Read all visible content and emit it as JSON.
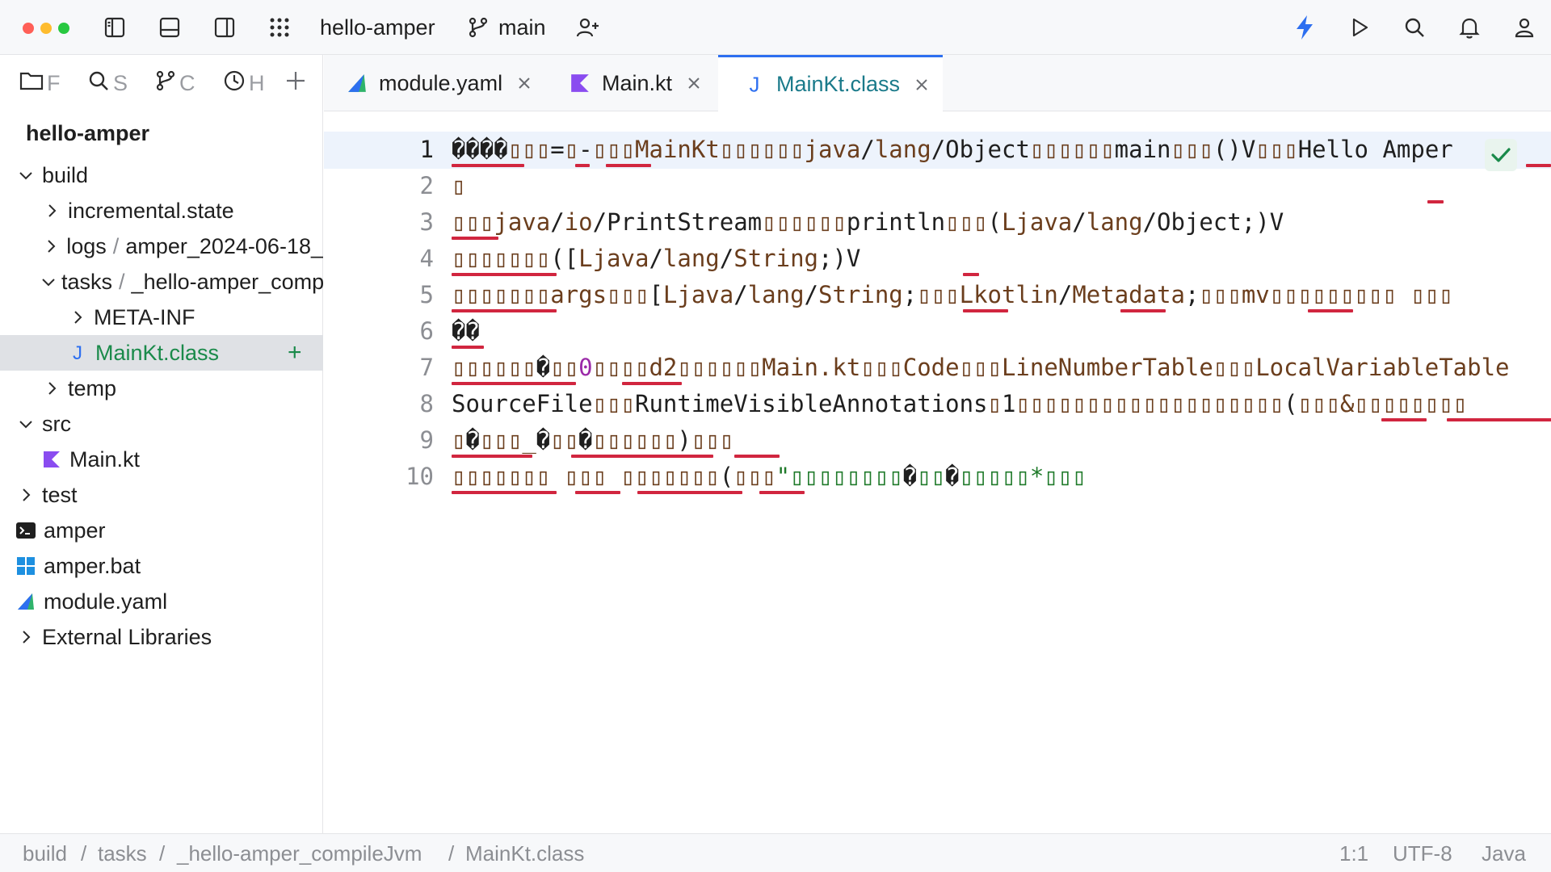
{
  "window": {
    "project_name": "hello-amper",
    "branch": "main"
  },
  "colors": {
    "accent": "#2d6ff0",
    "kotlin": "#8a4cf0",
    "java": "#2d6ff0",
    "error_underline": "#d1263f",
    "added_green": "#1a8a4a"
  },
  "sidebar": {
    "tabs": [
      {
        "label": "F",
        "icon": "folder-icon"
      },
      {
        "label": "S",
        "icon": "search-icon"
      },
      {
        "label": "C",
        "icon": "branch-icon"
      },
      {
        "label": "H",
        "icon": "clock-icon"
      },
      {
        "label": "+",
        "icon": "plus-icon"
      }
    ],
    "project_title": "hello-amper",
    "tree": [
      {
        "label": "build"
      },
      {
        "label": "incremental.state"
      },
      {
        "label": "logs",
        "suffix": "amper_2024-06-18_"
      },
      {
        "label": "tasks",
        "suffix": "_hello-amper_compileJvm"
      },
      {
        "label": "META-INF"
      },
      {
        "label": "MainKt.class",
        "badge": "+"
      },
      {
        "label": "temp"
      },
      {
        "label": "src"
      },
      {
        "label": "Main.kt"
      },
      {
        "label": "test"
      },
      {
        "label": "amper"
      },
      {
        "label": "amper.bat"
      },
      {
        "label": "module.yaml"
      },
      {
        "label": "External Libraries"
      }
    ]
  },
  "editor_tabs": [
    {
      "label": "module.yaml",
      "icon": "amper-icon"
    },
    {
      "label": "Main.kt",
      "icon": "kotlin-icon"
    },
    {
      "label": "MainKt.class",
      "icon": "java-icon",
      "active": true
    }
  ],
  "editor": {
    "line_numbers": [
      "1",
      "2",
      "3",
      "4",
      "5",
      "6",
      "7",
      "8",
      "9",
      "10"
    ],
    "lines": [
      [
        [
          "blk",
          "����"
        ],
        [
          "brown",
          "▯▯▯"
        ],
        [
          "blk",
          "="
        ],
        [
          "brown",
          "▯"
        ],
        [
          "blk",
          "-"
        ],
        [
          "brown",
          "▯▯▯MainKt▯▯▯▯▯▯java"
        ],
        [
          "blk",
          "/"
        ],
        [
          "brown",
          "lang"
        ],
        [
          "blk",
          "/Object"
        ],
        [
          "brown",
          "▯▯▯▯▯▯"
        ],
        [
          "blk",
          "main"
        ],
        [
          "brown",
          "▯▯▯"
        ],
        [
          "blk",
          "()V"
        ],
        [
          "brown",
          "▯▯▯"
        ],
        [
          "blk",
          "Hello Amper"
        ]
      ],
      [
        [
          "brown",
          "▯"
        ]
      ],
      [
        [
          "brown",
          "▯▯▯java"
        ],
        [
          "blk",
          "/"
        ],
        [
          "brown",
          "io"
        ],
        [
          "blk",
          "/PrintStream"
        ],
        [
          "brown",
          "▯▯▯▯▯▯"
        ],
        [
          "blk",
          "println"
        ],
        [
          "brown",
          "▯▯▯"
        ],
        [
          "blk",
          "("
        ],
        [
          "brown",
          "Ljava"
        ],
        [
          "blk",
          "/"
        ],
        [
          "brown",
          "lang"
        ],
        [
          "blk",
          "/Object;)V"
        ]
      ],
      [
        [
          "brown",
          "▯▯▯▯▯▯▯"
        ],
        [
          "blk",
          "(["
        ],
        [
          "brown",
          "Ljava"
        ],
        [
          "blk",
          "/"
        ],
        [
          "brown",
          "lang"
        ],
        [
          "blk",
          "/"
        ],
        [
          "brown",
          "String"
        ],
        [
          "blk",
          ";)V"
        ]
      ],
      [
        [
          "brown",
          "▯▯▯▯▯▯▯args▯▯▯"
        ],
        [
          "blk",
          "["
        ],
        [
          "brown",
          "Ljava"
        ],
        [
          "blk",
          "/"
        ],
        [
          "brown",
          "lang"
        ],
        [
          "blk",
          "/"
        ],
        [
          "brown",
          "String"
        ],
        [
          "blk",
          ";"
        ],
        [
          "brown",
          "▯▯▯Lkotlin"
        ],
        [
          "blk",
          "/"
        ],
        [
          "brown",
          "Metadata"
        ],
        [
          "blk",
          ";"
        ],
        [
          "brown",
          "▯▯▯mv▯▯▯▯▯▯▯▯▯ ▯▯▯"
        ]
      ],
      [
        [
          "blk",
          "��"
        ]
      ],
      [
        [
          "brown",
          "▯▯▯▯▯▯"
        ],
        [
          "blk",
          "�"
        ],
        [
          "brown",
          "▯▯"
        ],
        [
          "pur",
          "0"
        ],
        [
          "brown",
          "▯▯▯▯d2▯▯▯▯▯▯Main.kt▯▯▯Code▯▯▯LineNumberTable▯▯▯LocalVariableTable"
        ]
      ],
      [
        [
          "blk",
          "SourceFile"
        ],
        [
          "brown",
          "▯▯▯"
        ],
        [
          "blk",
          "RuntimeVisibleAnnotations"
        ],
        [
          "brown",
          "▯"
        ],
        [
          "blk",
          "1"
        ],
        [
          "brown",
          "▯▯▯▯▯▯▯▯▯▯▯▯▯▯▯▯▯▯▯"
        ],
        [
          "blk",
          "("
        ],
        [
          "brown",
          "▯▯▯&▯▯▯▯▯▯▯▯"
        ]
      ],
      [
        [
          "brown",
          "▯"
        ],
        [
          "blk",
          "�"
        ],
        [
          "brown",
          "▯▯▯_"
        ],
        [
          "blk",
          "�"
        ],
        [
          "brown",
          "▯▯"
        ],
        [
          "blk",
          "�"
        ],
        [
          "brown",
          "▯▯▯▯▯▯"
        ],
        [
          "blk",
          ")"
        ],
        [
          "brown",
          "▯▯▯"
        ]
      ],
      [
        [
          "brown",
          "▯▯▯▯▯▯▯ ▯▯▯ ▯▯▯▯▯▯▯"
        ],
        [
          "blk",
          "("
        ],
        [
          "brown",
          "▯▯▯"
        ],
        [
          "grn",
          "\"▯▯▯▯▯▯▯▯"
        ],
        [
          "blk",
          "�"
        ],
        [
          "grn",
          "▯▯"
        ],
        [
          "blk",
          "�"
        ],
        [
          "grn",
          "▯▯▯▯▯*▯▯▯"
        ]
      ]
    ]
  },
  "statusbar": {
    "breadcrumbs": [
      "build",
      "tasks",
      "_hello-amper_compileJvm",
      "MainKt.class"
    ],
    "separator": "/",
    "position": "1:1",
    "encoding": "UTF-8",
    "language": "Java"
  }
}
